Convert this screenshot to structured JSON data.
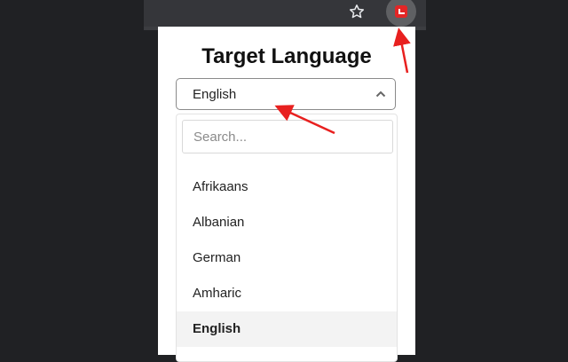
{
  "browser": {
    "star_icon": "star-icon",
    "extension_icon": "translate-extension-icon",
    "extension_color": "#e32626"
  },
  "popup": {
    "title": "Target Language",
    "selected_language": "English",
    "search": {
      "placeholder": "Search..."
    },
    "languages": [
      "Afrikaans",
      "Albanian",
      "German",
      "Amharic",
      "English"
    ],
    "highlighted_index": 4
  },
  "annotations": {
    "arrow_color": "#e8201f",
    "arrows": [
      "arrow-to-extension-icon",
      "arrow-to-language-select"
    ]
  }
}
